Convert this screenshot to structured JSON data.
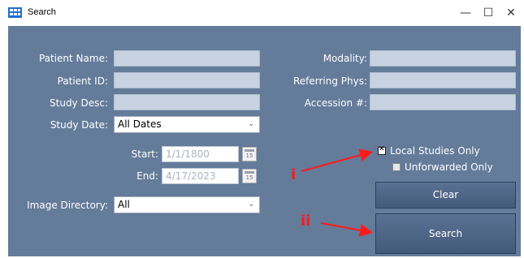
{
  "window": {
    "title": "Search",
    "minimize": "—",
    "maximize": "☐",
    "close": "✕"
  },
  "left": {
    "patient_name_label": "Patient Name:",
    "patient_id_label": "Patient ID:",
    "study_desc_label": "Study Desc:",
    "study_date_label": "Study Date:",
    "study_date_value": "All Dates",
    "start_label": "Start:",
    "start_value": "1/1/1800",
    "end_label": "End:",
    "end_value": "4/17/2023",
    "calendar_icon_text": "15",
    "image_directory_label": "Image Directory:",
    "image_directory_value": "All"
  },
  "right": {
    "modality_label": "Modality:",
    "referring_phys_label": "Referring Phys:",
    "accession_label": "Accession #:",
    "local_studies_label": "Local Studies Only",
    "local_studies_checked": true,
    "unforwarded_label": "Unforwarded Only",
    "unforwarded_checked": false,
    "clear_label": "Clear",
    "search_label": "Search"
  },
  "annotations": {
    "i": "i",
    "ii": "ii"
  },
  "colors": {
    "panel": "#647b9a",
    "field": "#c7d3e1",
    "annotation": "#ff1a1a",
    "button": "#4f6687"
  }
}
